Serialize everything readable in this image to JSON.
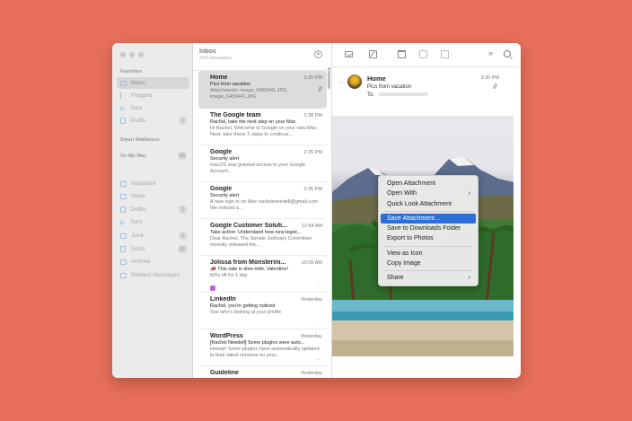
{
  "sidebar": {
    "favorites_label": "Favorites",
    "smart_label": "Smart Mailboxes",
    "onmymac_label": "On My Mac",
    "onmymac_badge": "60",
    "favorites": [
      {
        "label": "Inbox",
        "badge": ""
      },
      {
        "label": "Flagged",
        "badge": ""
      },
      {
        "label": "Sent",
        "badge": ""
      },
      {
        "label": "Drafts",
        "badge": "1"
      }
    ],
    "onmymac": [
      {
        "label": "Important",
        "badge": ""
      },
      {
        "label": "Inbox",
        "badge": ""
      },
      {
        "label": "Drafts",
        "badge": "1"
      },
      {
        "label": "Sent",
        "badge": ""
      },
      {
        "label": "Junk",
        "badge": "1"
      },
      {
        "label": "Trash",
        "badge": "12"
      },
      {
        "label": "Archive",
        "badge": ""
      },
      {
        "label": "Deleted Messages",
        "badge": ""
      }
    ]
  },
  "list": {
    "title": "Inbox",
    "subtitle": "243 messages",
    "messages": [
      {
        "sender": "Home",
        "time": "3:30 PM",
        "subject": "Pics from vacation",
        "preview": "Attachments: image_6483441.JPG, image_6483441.JPG"
      },
      {
        "sender": "The Google team",
        "time": "2:38 PM",
        "subject": "Rachel, take the next step on your Mac",
        "preview": "Hi Rachel, Welcome to Google on your new Mac. Next, take these 2 steps to continue..."
      },
      {
        "sender": "Google",
        "time": "2:35 PM",
        "subject": "Security alert",
        "preview": "macOS was granted access to your Google Account..."
      },
      {
        "sender": "Google",
        "time": "2:35 PM",
        "subject": "Security alert",
        "preview": "A new sign-in on Mac rachelsneedell@gmail.com We noticed a..."
      },
      {
        "sender": "Google Customer Soluti...",
        "time": "11:54 AM",
        "subject": "Take action: Understand how new legisl...",
        "preview": "Dear Rachel, The Senate Judiciary Committee recently released the..."
      },
      {
        "sender": "Jolissa from Monsterini...",
        "time": "10:00 AM",
        "subject": "📣 This sale is dino-mite, Valentine!",
        "preview": "60% off for 1 day"
      },
      {
        "sender": "LinkedIn",
        "time": "Yesterday",
        "subject": "Rachel, you're getting noticed",
        "preview": "See who's looking at your profile"
      },
      {
        "sender": "WordPress",
        "time": "Yesterday",
        "subject": "[Rachel Needell] Some plugins were auto...",
        "preview": "Howdy! Some plugins have automatically updated to their latest versions on your..."
      },
      {
        "sender": "Guideline",
        "time": "Yesterday",
        "subject": "",
        "preview": ""
      }
    ]
  },
  "detail": {
    "from": "Home",
    "subject": "Pics from vacation",
    "to_label": "To:",
    "time": "3:30 PM"
  },
  "context_menu": {
    "groups": [
      [
        "Open Attachment",
        "Open With",
        "Quick Look Attachment"
      ],
      [
        "Save Attachment...",
        "Save to Downloads Folder",
        "Export to Photos"
      ],
      [
        "View as Icon",
        "Copy Image"
      ],
      [
        "Share"
      ]
    ],
    "highlighted": "Save Attachment...",
    "submenu_items": [
      "Open With",
      "Share"
    ]
  },
  "colors": {
    "background": "#e8705a",
    "highlight": "#2d6fd6"
  }
}
